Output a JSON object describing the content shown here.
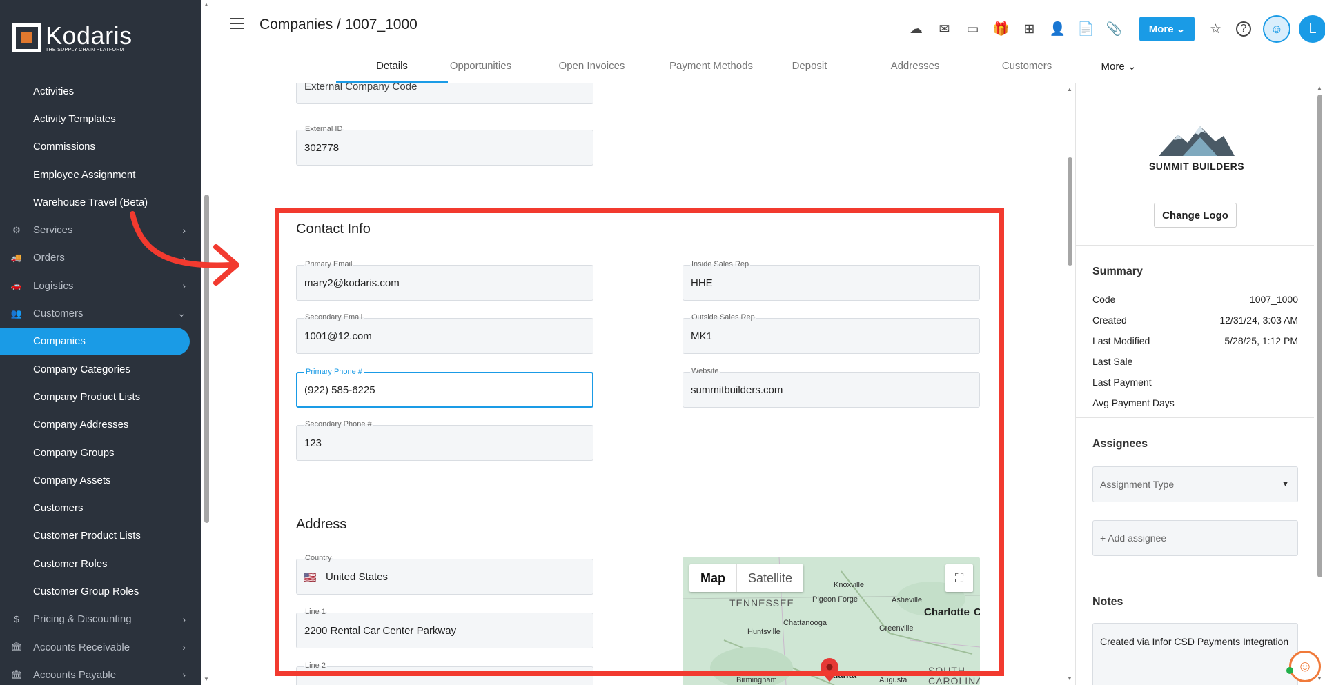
{
  "brand": {
    "name": "Kodaris",
    "tagline": "THE SUPPLY CHAIN PLATFORM",
    "accent": "#1a9be6",
    "highlight": "#f23a2f"
  },
  "sidebar": {
    "items": [
      {
        "label": "Activities",
        "type": "child"
      },
      {
        "label": "Activity Templates",
        "type": "child"
      },
      {
        "label": "Commissions",
        "type": "child"
      },
      {
        "label": "Employee Assignment",
        "type": "child"
      },
      {
        "label": "Warehouse Travel (Beta)",
        "type": "child"
      },
      {
        "label": "Services",
        "type": "section",
        "icon": "gears-icon",
        "glyph": "⚙",
        "chev": "›"
      },
      {
        "label": "Orders",
        "type": "section",
        "icon": "truck-icon",
        "glyph": "🚚",
        "chev": "›"
      },
      {
        "label": "Logistics",
        "type": "section",
        "icon": "car-icon",
        "glyph": "🚗",
        "chev": "›"
      },
      {
        "label": "Customers",
        "type": "section",
        "icon": "people-icon",
        "glyph": "👥",
        "chev": "⌄"
      },
      {
        "label": "Companies",
        "type": "active"
      },
      {
        "label": "Company Categories",
        "type": "child"
      },
      {
        "label": "Company Product Lists",
        "type": "child"
      },
      {
        "label": "Company Addresses",
        "type": "child"
      },
      {
        "label": "Company Groups",
        "type": "child"
      },
      {
        "label": "Company Assets",
        "type": "child"
      },
      {
        "label": "Customers",
        "type": "child"
      },
      {
        "label": "Customer Product Lists",
        "type": "child"
      },
      {
        "label": "Customer Roles",
        "type": "child"
      },
      {
        "label": "Customer Group Roles",
        "type": "child"
      },
      {
        "label": "Pricing & Discounting",
        "type": "section",
        "icon": "dollar-icon",
        "glyph": "$",
        "chev": "›"
      },
      {
        "label": "Accounts Receivable",
        "type": "section",
        "icon": "bank-icon",
        "glyph": "🏛",
        "chev": "›"
      },
      {
        "label": "Accounts Payable",
        "type": "section",
        "icon": "bank-icon",
        "glyph": "🏛",
        "chev": "›"
      }
    ]
  },
  "header": {
    "breadcrumb": "Companies / 1007_1000",
    "icons": [
      {
        "name": "cloud-upload-icon",
        "glyph": "☁"
      },
      {
        "name": "mail-icon",
        "glyph": "✉"
      },
      {
        "name": "card-icon",
        "glyph": "▭"
      },
      {
        "name": "gift-icon",
        "glyph": "🎁"
      },
      {
        "name": "screen-add-icon",
        "glyph": "⊞"
      },
      {
        "name": "person-add-icon",
        "glyph": "👤"
      },
      {
        "name": "file-add-icon",
        "glyph": "📄"
      },
      {
        "name": "attachment-icon",
        "glyph": "📎"
      }
    ],
    "more_label": "More ⌄",
    "star": "☆",
    "help": "?",
    "bot": "☺",
    "avatar": "L"
  },
  "tabs": [
    {
      "label": "Details",
      "active": true
    },
    {
      "label": "Opportunities"
    },
    {
      "label": "Open Invoices"
    },
    {
      "label": "Payment Methods"
    },
    {
      "label": "Deposit"
    },
    {
      "label": "Addresses"
    },
    {
      "label": "Customers"
    },
    {
      "label": "More ⌄"
    }
  ],
  "form": {
    "external_company_code": {
      "placeholder": "External Company Code"
    },
    "external_id": {
      "label": "External ID",
      "value": "302778"
    },
    "contact_info": {
      "title": "Contact Info",
      "primary_email": {
        "label": "Primary Email",
        "value": "mary2@kodaris.com"
      },
      "secondary_email": {
        "label": "Secondary Email",
        "value": "1001@12.com"
      },
      "primary_phone": {
        "label": "Primary Phone #",
        "value": "(922) 585-6225"
      },
      "secondary_phone": {
        "label": "Secondary Phone #",
        "value": "123"
      },
      "inside_sales_rep": {
        "label": "Inside Sales Rep",
        "value": "HHE"
      },
      "outside_sales_rep": {
        "label": "Outside Sales Rep",
        "value": "MK1"
      },
      "website": {
        "label": "Website",
        "value": "summitbuilders.com"
      }
    },
    "address": {
      "title": "Address",
      "country": {
        "label": "Country",
        "value": "United States",
        "flag": "🇺🇸"
      },
      "line1": {
        "label": "Line 1",
        "value": "2200 Rental Car Center Parkway"
      },
      "line2": {
        "label": "Line 2"
      }
    }
  },
  "map": {
    "map_label": "Map",
    "satellite_label": "Satellite",
    "fullscreen": "⛶",
    "places": {
      "knoxville": "Knoxville",
      "tennessee": "TENNESSEE",
      "pigeon_forge": "Pigeon Forge",
      "asheville": "Asheville",
      "charlotte": "Charlotte",
      "chattanooga": "Chattanooga",
      "huntsville": "Huntsville",
      "greenville": "Greenville",
      "birmingham": "Birmingham",
      "atlanta": "Atlanta",
      "augusta": "Augusta",
      "south_carolina": "SOUTH CAROLINA",
      "c_edge": "C"
    }
  },
  "right_panel": {
    "company_name": "SUMMIT BUILDERS",
    "change_logo": "Change Logo",
    "summary": {
      "title": "Summary",
      "rows": [
        {
          "label": "Code",
          "value": "1007_1000"
        },
        {
          "label": "Created",
          "value": "12/31/24, 3:03 AM"
        },
        {
          "label": "Last Modified",
          "value": "5/28/25, 1:12 PM"
        },
        {
          "label": "Last Sale",
          "value": ""
        },
        {
          "label": "Last Payment",
          "value": ""
        },
        {
          "label": "Avg Payment Days",
          "value": ""
        }
      ]
    },
    "assignees": {
      "title": "Assignees",
      "assignment_type": "Assignment Type",
      "add_assignee": "+ Add assignee"
    },
    "notes": {
      "title": "Notes",
      "text": "Created via Infor CSD Payments Integration"
    }
  }
}
